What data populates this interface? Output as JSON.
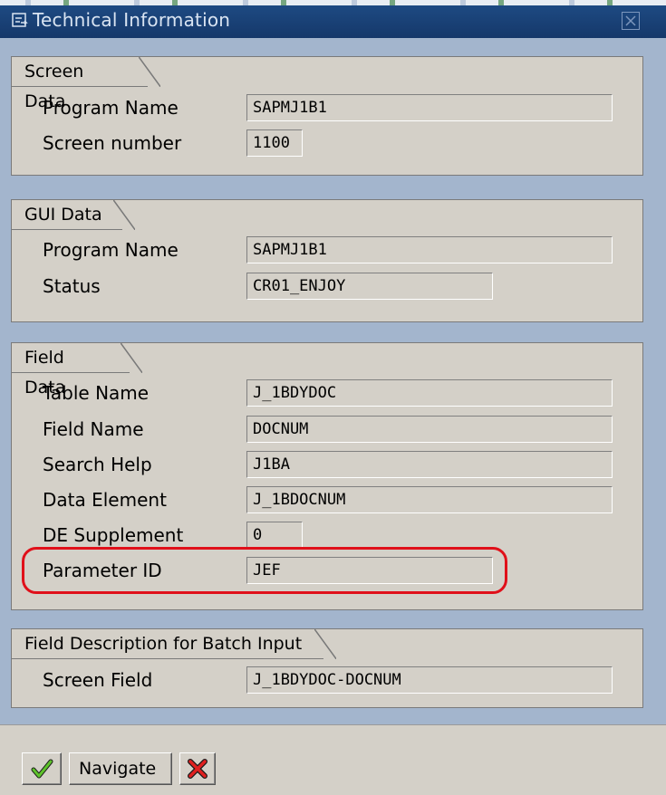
{
  "window": {
    "title": "Technical Information"
  },
  "groups": {
    "screen_data": {
      "title": "Screen Data",
      "rows": [
        {
          "label": "Program Name",
          "value": "SAPMJ1B1"
        },
        {
          "label": "Screen number",
          "value": "1100"
        }
      ]
    },
    "gui_data": {
      "title": "GUI Data",
      "rows": [
        {
          "label": "Program Name",
          "value": "SAPMJ1B1"
        },
        {
          "label": "Status",
          "value": "CR01_ENJOY"
        }
      ]
    },
    "field_data": {
      "title": "Field Data",
      "rows": [
        {
          "label": "Table Name",
          "value": "J_1BDYDOC"
        },
        {
          "label": "Field Name",
          "value": "DOCNUM"
        },
        {
          "label": "Search Help",
          "value": "J1BA"
        },
        {
          "label": "Data Element",
          "value": "J_1BDOCNUM"
        },
        {
          "label": "DE Supplement",
          "value": "0"
        },
        {
          "label": "Parameter ID",
          "value": "JEF"
        }
      ]
    },
    "batch_input": {
      "title": "Field Description for Batch Input",
      "rows": [
        {
          "label": "Screen Field",
          "value": "J_1BDYDOC-DOCNUM"
        }
      ]
    }
  },
  "toolbar": {
    "navigate_label": "Navigate",
    "confirm_icon": "checkmark-icon",
    "cancel_icon": "cancel-x-icon"
  },
  "colors": {
    "highlight": "#e0101a",
    "titlebar": "#1f4d86"
  }
}
